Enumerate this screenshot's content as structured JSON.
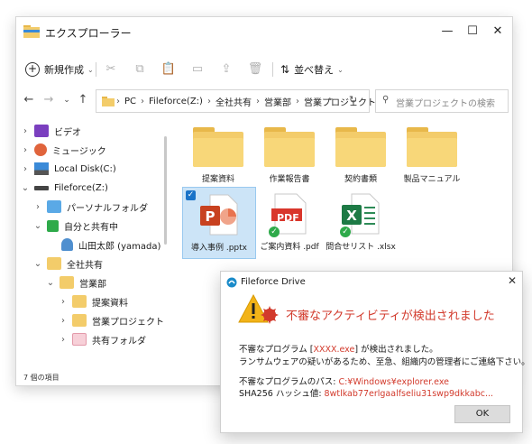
{
  "window": {
    "title": "エクスプローラー",
    "controls": {
      "minimize": "—",
      "maximize": "☐",
      "close": "✕"
    }
  },
  "toolbar": {
    "new_label": "新規作成",
    "sort_label": "並べ替え",
    "icons": [
      "cut-icon",
      "copy-icon",
      "paste-icon",
      "rename-icon",
      "share-icon",
      "delete-icon"
    ]
  },
  "address": {
    "crumbs": [
      "PC",
      "Fileforce(Z:)",
      "全社共有",
      "営業部",
      "営業プロジェクト"
    ],
    "search_placeholder": "営業プロジェクトの検索"
  },
  "sidebar": {
    "items": [
      {
        "label": "ビデオ"
      },
      {
        "label": "ミュージック"
      },
      {
        "label": "Local Disk(C:)"
      },
      {
        "label": "Fileforce(Z:)"
      },
      {
        "label": "パーソナルフォルダ"
      },
      {
        "label": "自分と共有中"
      },
      {
        "label": "山田太郎 (yamada)"
      },
      {
        "label": "全社共有"
      },
      {
        "label": "営業部"
      },
      {
        "label": "提案資料"
      },
      {
        "label": "営業プロジェクト"
      },
      {
        "label": "共有フォルダ"
      }
    ]
  },
  "status": {
    "count": "7 個の項目"
  },
  "files": [
    {
      "name": "提案資料",
      "kind": "folder"
    },
    {
      "name": "作業報告書",
      "kind": "folder"
    },
    {
      "name": "契約書類",
      "kind": "folder"
    },
    {
      "name": "製品マニュアル",
      "kind": "folder"
    },
    {
      "name": "導入事例 .pptx",
      "kind": "pptx"
    },
    {
      "name": "ご案内資料 .pdf",
      "kind": "pdf",
      "pdf_label": "PDF"
    },
    {
      "name": "問合せリスト .xlsx",
      "kind": "xlsx"
    }
  ],
  "dialog": {
    "title": "Fileforce Drive",
    "heading": "不審なアクティビティが検出されました",
    "line1_pre": "不審なプログラム [",
    "line1_prog": "XXXX.exe",
    "line1_post": "] が検出されました。",
    "line2": "ランサムウェアの疑いがあるため、至急、組織内の管理者にご連絡下さい。",
    "path_label": "不審なプログラムのパス: ",
    "path_value": "C:¥Windows¥explorer.exe",
    "hash_label": "SHA256 ハッシュ値: ",
    "hash_value": "8wtlkab77erlgaalfseliu31swp9dkkabc...",
    "ok_label": "OK"
  },
  "colors": {
    "accent": "#1a73c8",
    "alert": "#d23a2c",
    "folder": "#f3cc6a"
  }
}
